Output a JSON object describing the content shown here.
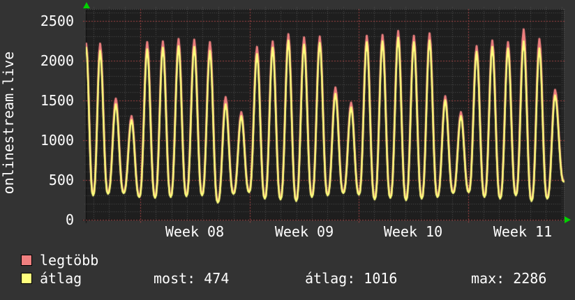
{
  "colors": {
    "page_bg": "#333333",
    "plot_bg": "#1e1e1e",
    "grid_minor": "#4e4e4e",
    "grid_major": "#a34242",
    "border_gray": "#5a5a5a",
    "axis_line": "#0a0a0a",
    "arrow_green": "#00d000",
    "text": "#ffffff",
    "series_max": "#f08080",
    "series_avg": "#ffff7d"
  },
  "chart": {
    "axis_title": "onlinestream.live",
    "y_ticks": [
      "2500",
      "2000",
      "1500",
      "1000",
      "500",
      "0"
    ],
    "week_labels": [
      "Week 08",
      "Week 09",
      "Week 10",
      "Week 11"
    ],
    "legend": [
      {
        "label": "legtöbb"
      },
      {
        "label": "átlag"
      }
    ],
    "stats_row": {
      "most": "most: 474",
      "avg": "átlag: 1016",
      "max": "max: 2286"
    }
  },
  "chart_data": {
    "type": "line",
    "title": "onlinestream.live",
    "ylabel": "onlinestream.live",
    "ylim": [
      0,
      2650
    ],
    "y_ticks": [
      0,
      500,
      1000,
      1500,
      2000,
      2500
    ],
    "y_minor_step": 100,
    "x_tick_labels": [
      "Week 08",
      "Week 09",
      "Week 10",
      "Week 11"
    ],
    "grid": "dotted, red major lines every 500 units and every week, gray minor lines every 100 units and every day",
    "legend_position": "bottom-left",
    "description": "Daily oscillating viewer counts over ~31 days; each day rises from a night trough to an evening peak",
    "series": [
      {
        "name": "legtöbb",
        "color": "#f08080",
        "daily_peaks": [
          2210,
          2210,
          1520,
          1300,
          2230,
          2240,
          2270,
          2260,
          2230,
          1540,
          1350,
          2170,
          2240,
          2330,
          2290,
          2300,
          1660,
          1470,
          2310,
          2320,
          2370,
          2310,
          2340,
          1550,
          1350,
          2180,
          2250,
          2230,
          2390,
          2270,
          1630
        ],
        "trough_offset": 20,
        "end_value": 485
      },
      {
        "name": "átlag",
        "color": "#ffff7d",
        "daily_peaks": [
          2160,
          2120,
          1450,
          1250,
          2140,
          2160,
          2180,
          2170,
          2120,
          1450,
          1300,
          2080,
          2160,
          2250,
          2200,
          2220,
          1580,
          1410,
          2230,
          2240,
          2286,
          2230,
          2250,
          1500,
          1300,
          2110,
          2170,
          2150,
          2240,
          2150,
          1560
        ],
        "trough_offset": 0,
        "end_value": 474
      }
    ],
    "daily_troughs": [
      300,
      320,
      330,
      280,
      270,
      280,
      290,
      300,
      210,
      320,
      340,
      260,
      250,
      230,
      280,
      300,
      330,
      310,
      250,
      270,
      240,
      260,
      280,
      330,
      340,
      280,
      260,
      300,
      230,
      260
    ],
    "stats": {
      "most": 474,
      "atlag": 1016,
      "max": 2286
    }
  }
}
